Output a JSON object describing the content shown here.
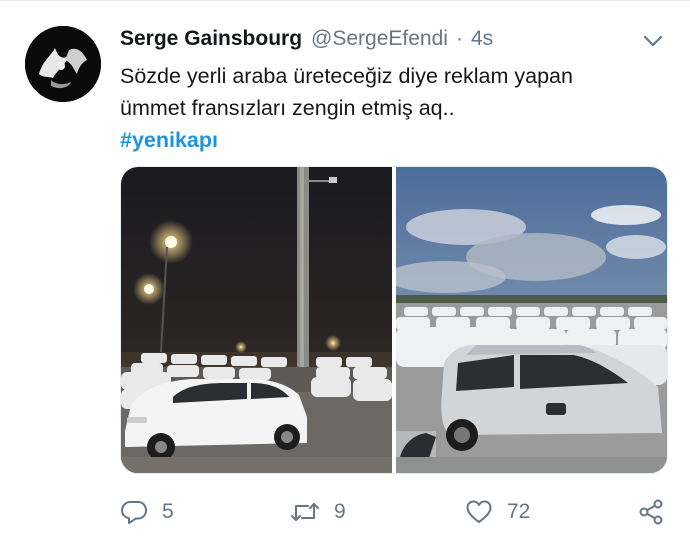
{
  "tweet": {
    "display_name": "Serge Gainsbourg",
    "handle": "@SergeEfendi",
    "separator": "·",
    "timestamp": "4s",
    "text_lines": [
      "Sözde yerli araba üreteceğiz diye reklam yapan",
      "ümmet fransızları zengin etmiş aq.."
    ],
    "hashtag": "#yenikapı",
    "media": [
      {
        "kind": "photo",
        "subject": "night-parking-lot-white-cars"
      },
      {
        "kind": "photo",
        "subject": "daytime-parking-lot-white-cars"
      }
    ]
  },
  "actions": {
    "reply": {
      "icon": "reply-icon",
      "count": "5"
    },
    "retweet": {
      "icon": "retweet-icon",
      "count": "9"
    },
    "like": {
      "icon": "heart-icon",
      "count": "72"
    },
    "share": {
      "icon": "share-icon"
    }
  },
  "colors": {
    "text": "#14171a",
    "secondary": "#657786",
    "link": "#1b95e0",
    "border": "#e6ecf0"
  }
}
